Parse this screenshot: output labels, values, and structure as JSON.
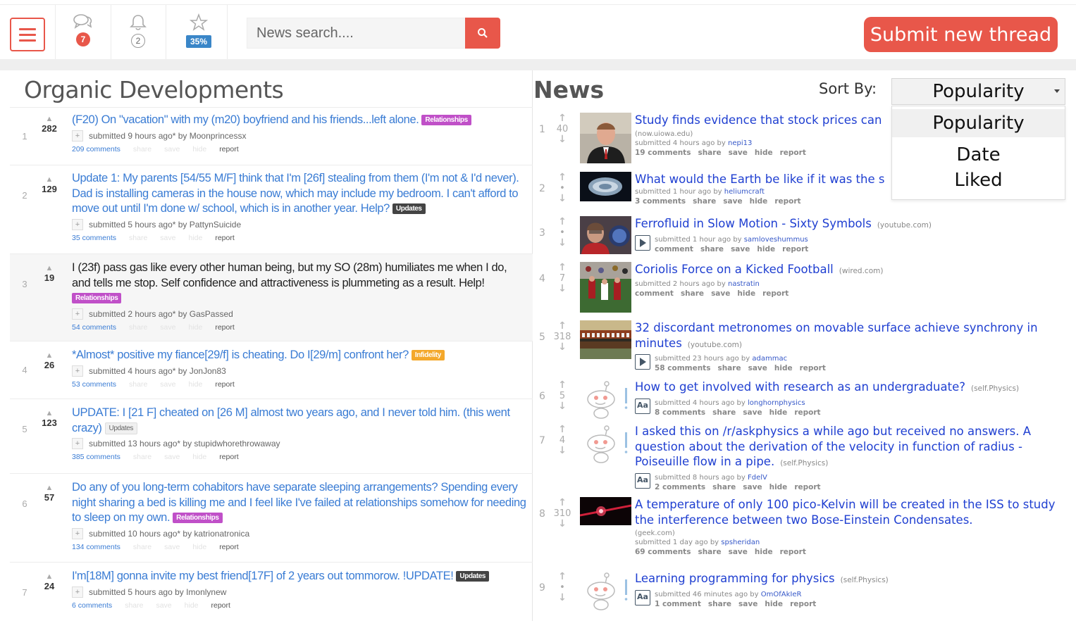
{
  "header": {
    "chat_badge": "7",
    "bell_badge": "2",
    "star_badge": "35%",
    "search_placeholder": "News search....",
    "submit_label": "Submit new thread"
  },
  "colors": {
    "accent": "#e8574a",
    "link_blue": "#3a7cd4",
    "news_link": "#1f3fd1"
  },
  "left": {
    "title": "Organic Developments",
    "posts": [
      {
        "rank": "1",
        "score": "282",
        "title": "(F20) On \"vacation\" with my (m20) boyfriend and his friends...left alone.",
        "tag": "Relationships",
        "meta": "submitted 9 hours ago* by Moonprincessx",
        "comments": "209 comments",
        "share": "share",
        "save": "save",
        "hide": "hide",
        "report": "report"
      },
      {
        "rank": "2",
        "score": "129",
        "title": "Update 1: My parents [54/55 M/F] think that I'm [26f] stealing from them (I'm not & I'd never). Dad is installing cameras in the house now, which may include my bedroom. I can't afford to move out until I'm done w/ school, which is in another year. Help?",
        "tag": "Updates",
        "meta": "submitted 5 hours ago* by PattynSuicide",
        "comments": "35 comments",
        "share": "share",
        "save": "save",
        "hide": "hide",
        "report": "report"
      },
      {
        "rank": "3",
        "score": "19",
        "title": "I (23f) pass gas like every other human being, but my SO (28m) humiliates me when I do, and tells me stop. Self confidence and attractiveness is plummeting as a result. Help!",
        "tag": "Relationships",
        "meta": "submitted 2 hours ago* by GasPassed",
        "comments": "54 comments",
        "share": "share",
        "save": "save",
        "hide": "hide",
        "report": "report"
      },
      {
        "rank": "4",
        "score": "26",
        "title": "*Almost* positive my fiance[29/f] is cheating. Do I[29/m] confront her?",
        "tag": "Infidelity",
        "meta": "submitted 4 hours ago* by JonJon83",
        "comments": "53 comments",
        "share": "share",
        "save": "save",
        "hide": "hide",
        "report": "report"
      },
      {
        "rank": "5",
        "score": "123",
        "title": "UPDATE: I [21 F] cheated on [26 M] almost two years ago, and I never told him. (this went crazy)",
        "tag": "Updates",
        "meta": "submitted 13 hours ago* by stupidwhorethrowaway",
        "comments": "385 comments",
        "share": "share",
        "save": "save",
        "hide": "hide",
        "report": "report"
      },
      {
        "rank": "6",
        "score": "57",
        "title": "Do any of you long-term cohabitors have separate sleeping arrangements? Spending every night sharing a bed is killing me and I feel like I've failed at relationships somehow for needing to sleep on my own.",
        "tag": "Relationships",
        "meta": "submitted 10 hours ago* by katrionatronica",
        "comments": "134 comments",
        "share": "share",
        "save": "save",
        "hide": "hide",
        "report": "report"
      },
      {
        "rank": "7",
        "score": "24",
        "title": "I'm[18M] gonna invite my best friend[17F] of 2 years out tommorow. !UPDATE!",
        "tag": "Updates",
        "meta": "submitted 5 hours ago by Imonlynew",
        "comments": "6 comments",
        "share": "share",
        "save": "save",
        "hide": "hide",
        "report": "report"
      }
    ]
  },
  "right": {
    "title": "News",
    "sort_label": "Sort By:",
    "sort_selected": "Popularity",
    "sort_options": [
      "Popularity",
      "Date",
      "Liked"
    ],
    "links": [
      {
        "rank": "1",
        "score": "40",
        "title": "Study finds evidence that stock prices can",
        "domain": "(now.uiowa.edu)",
        "time": "submitted 4 hours ago by",
        "author": "nepi13",
        "links": [
          "19 comments",
          "share",
          "save",
          "hide",
          "report"
        ]
      },
      {
        "rank": "2",
        "score": "•",
        "title": "What would the Earth be like if it was the s",
        "domain": "",
        "time": "submitted 1 hour ago by",
        "author": "heliumcraft",
        "links": [
          "3 comments",
          "share",
          "save",
          "hide",
          "report"
        ]
      },
      {
        "rank": "3",
        "score": "•",
        "title": "Ferrofluid in Slow Motion - Sixty Symbols",
        "domain": "(youtube.com)",
        "time": "submitted 1 hour ago by",
        "author": "samloveshummus",
        "links": [
          "comment",
          "share",
          "save",
          "hide",
          "report"
        ]
      },
      {
        "rank": "4",
        "score": "7",
        "title": "Coriolis Force on a Kicked Football",
        "domain": "(wired.com)",
        "time": "submitted 2 hours ago by",
        "author": "nastratin",
        "links": [
          "comment",
          "share",
          "save",
          "hide",
          "report"
        ]
      },
      {
        "rank": "5",
        "score": "318",
        "title": "32 discordant metronomes on movable surface achieve synchrony in minutes",
        "domain": "(youtube.com)",
        "time": "submitted 23 hours ago by",
        "author": "adammac",
        "links": [
          "58 comments",
          "share",
          "save",
          "hide",
          "report"
        ]
      },
      {
        "rank": "6",
        "score": "5",
        "title": "How to get involved with research as an undergraduate?",
        "domain": "(self.Physics)",
        "time": "submitted 4 hours ago by",
        "author": "longhornphysics",
        "links": [
          "8 comments",
          "share",
          "save",
          "hide",
          "report"
        ]
      },
      {
        "rank": "7",
        "score": "4",
        "title": "I asked this on /r/askphysics a while ago but received no answers. A question about the derivation of the velocity in function of radius - Poiseuille flow in a pipe.",
        "domain": "(self.Physics)",
        "time": "submitted 8 hours ago by",
        "author": "FdelV",
        "links": [
          "2 comments",
          "share",
          "save",
          "hide",
          "report"
        ]
      },
      {
        "rank": "8",
        "score": "310",
        "title": "A temperature of only 100 pico-Kelvin will be created in the ISS to study the interference between two Bose-Einstein Condensates.",
        "domain": "(geek.com)",
        "time": "submitted 1 day ago by",
        "author": "spsheridan",
        "links": [
          "69 comments",
          "share",
          "save",
          "hide",
          "report"
        ]
      },
      {
        "rank": "9",
        "score": "•",
        "title": "Learning programming for physics",
        "domain": "(self.Physics)",
        "time": "submitted 46 minutes ago by",
        "author": "OmOfAkIeR",
        "links": [
          "1 comment",
          "share",
          "save",
          "hide",
          "report"
        ]
      }
    ]
  }
}
